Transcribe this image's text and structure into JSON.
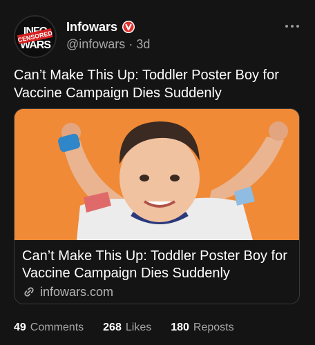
{
  "post": {
    "author_name": "Infowars",
    "handle": "@infowars",
    "separator": "·",
    "age": "3d",
    "text": "Can’t Make This Up: Toddler Poster Boy for Vaccine Campaign Dies Suddenly",
    "avatar_logo_text": "INFOWARS",
    "avatar_stamp_text": "CENSORED"
  },
  "card": {
    "title": "Can’t Make This Up: Toddler Poster Boy for Vaccine Campaign Dies Suddenly",
    "domain": "infowars.com"
  },
  "stats": [
    {
      "count": "49",
      "label": "Comments"
    },
    {
      "count": "268",
      "label": "Likes"
    },
    {
      "count": "180",
      "label": "Reposts"
    }
  ],
  "colors": {
    "background": "#141414",
    "verified_badge": "#e0322f",
    "card_image_bg": "#f08a37",
    "muted_text": "#a7a7a7"
  },
  "icons": [
    "verified-badge-icon",
    "more-options-icon",
    "link-icon"
  ]
}
